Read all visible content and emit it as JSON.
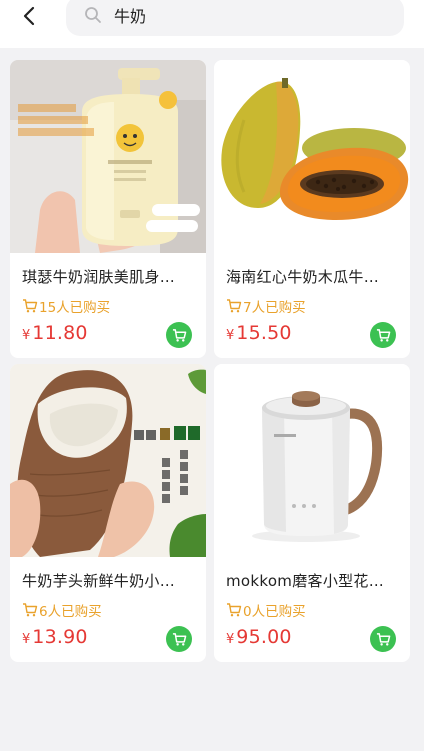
{
  "search": {
    "query": "牛奶"
  },
  "colors": {
    "price": "#e53935",
    "buyers": "#e9a22c",
    "cart_button": "#3cc152"
  },
  "products": [
    {
      "name": "琪瑟牛奶润肤美肌身…",
      "buyers": "15人已购买",
      "currency": "¥",
      "price": "11.80",
      "image": "lotion-bottle-image"
    },
    {
      "name": "海南红心牛奶木瓜牛…",
      "buyers": "7人已购买",
      "currency": "¥",
      "price": "15.50",
      "image": "papaya-image"
    },
    {
      "name": "牛奶芋头新鲜牛奶小…",
      "buyers": "6人已购买",
      "currency": "¥",
      "price": "13.90",
      "image": "taro-image"
    },
    {
      "name": "mokkom磨客小型花…",
      "buyers": "0人已购买",
      "currency": "¥",
      "price": "95.00",
      "image": "kettle-image"
    }
  ]
}
